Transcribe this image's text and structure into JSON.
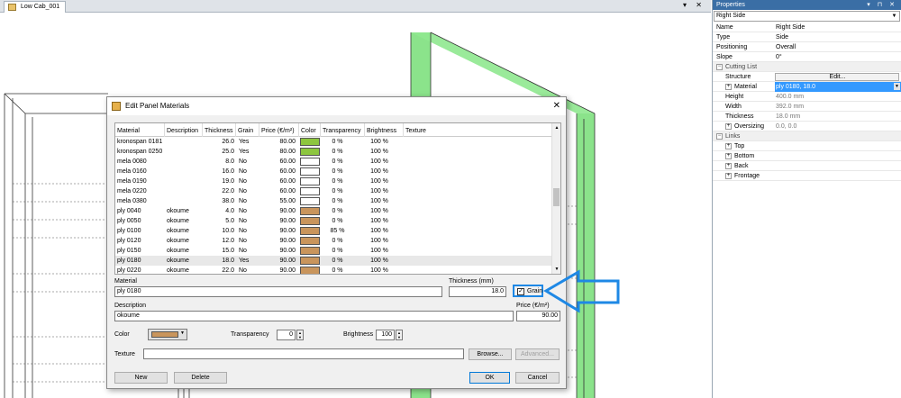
{
  "document_tab": {
    "title": "Low Cab_001"
  },
  "viewport_controls": {
    "pin": "▾",
    "close": "✕"
  },
  "properties": {
    "title": "Properties",
    "controls": "▾ ⊓ ✕",
    "selected_object": "Right Side",
    "rows": [
      {
        "key": "Name",
        "value": "Right Side"
      },
      {
        "key": "Type",
        "value": "Side"
      },
      {
        "key": "Positioning",
        "value": "Overall"
      },
      {
        "key": "Slope",
        "value": "0°"
      }
    ],
    "cutting_list": {
      "label": "Cutting List",
      "structure_key": "Structure",
      "structure_value": "Edit...",
      "material_key": "Material",
      "material_value": "ply 0180, 18.0",
      "height_key": "Height",
      "height_value": "400.0 mm",
      "width_key": "Width",
      "width_value": "392.0 mm",
      "thickness_key": "Thickness",
      "thickness_value": "18.0 mm",
      "oversizing_key": "Oversizing",
      "oversizing_value": "0.0, 0.0"
    },
    "links": {
      "label": "Links",
      "items": [
        "Top",
        "Bottom",
        "Back",
        "Frontage"
      ]
    }
  },
  "dialog": {
    "title": "Edit Panel Materials",
    "close": "✕",
    "columns": [
      "Material",
      "Description",
      "Thickness",
      "Grain",
      "Price (€/m²)",
      "Color",
      "Transparency",
      "Brightness",
      "Texture"
    ],
    "rows": [
      {
        "material": "kronospan 0181",
        "description": "",
        "thickness": "26.0",
        "grain": "Yes",
        "price": "80.00",
        "color": "#8dc63f",
        "transparency": "0 %",
        "brightness": "100 %"
      },
      {
        "material": "kronospan 0250",
        "description": "",
        "thickness": "25.0",
        "grain": "Yes",
        "price": "80.00",
        "color": "#8dc63f",
        "transparency": "0 %",
        "brightness": "100 %"
      },
      {
        "material": "mela 0080",
        "description": "",
        "thickness": "8.0",
        "grain": "No",
        "price": "60.00",
        "color": "#ffffff",
        "transparency": "0 %",
        "brightness": "100 %"
      },
      {
        "material": "mela 0160",
        "description": "",
        "thickness": "16.0",
        "grain": "No",
        "price": "60.00",
        "color": "#ffffff",
        "transparency": "0 %",
        "brightness": "100 %"
      },
      {
        "material": "mela 0190",
        "description": "",
        "thickness": "19.0",
        "grain": "No",
        "price": "60.00",
        "color": "#ffffff",
        "transparency": "0 %",
        "brightness": "100 %"
      },
      {
        "material": "mela 0220",
        "description": "",
        "thickness": "22.0",
        "grain": "No",
        "price": "60.00",
        "color": "#ffffff",
        "transparency": "0 %",
        "brightness": "100 %"
      },
      {
        "material": "mela 0380",
        "description": "",
        "thickness": "38.0",
        "grain": "No",
        "price": "55.00",
        "color": "#ffffff",
        "transparency": "0 %",
        "brightness": "100 %"
      },
      {
        "material": "ply 0040",
        "description": "okoume",
        "thickness": "4.0",
        "grain": "No",
        "price": "90.00",
        "color": "#c9955c",
        "transparency": "0 %",
        "brightness": "100 %"
      },
      {
        "material": "ply 0050",
        "description": "okoume",
        "thickness": "5.0",
        "grain": "No",
        "price": "90.00",
        "color": "#c9955c",
        "transparency": "0 %",
        "brightness": "100 %"
      },
      {
        "material": "ply 0100",
        "description": "okoume",
        "thickness": "10.0",
        "grain": "No",
        "price": "90.00",
        "color": "#c9955c",
        "transparency": "85 %",
        "brightness": "100 %"
      },
      {
        "material": "ply 0120",
        "description": "okoume",
        "thickness": "12.0",
        "grain": "No",
        "price": "90.00",
        "color": "#c9955c",
        "transparency": "0 %",
        "brightness": "100 %"
      },
      {
        "material": "ply 0150",
        "description": "okoume",
        "thickness": "15.0",
        "grain": "No",
        "price": "90.00",
        "color": "#c9955c",
        "transparency": "0 %",
        "brightness": "100 %"
      },
      {
        "material": "ply 0180",
        "description": "okoume",
        "thickness": "18.0",
        "grain": "Yes",
        "price": "90.00",
        "color": "#c9955c",
        "transparency": "0 %",
        "brightness": "100 %",
        "selected": true
      },
      {
        "material": "ply 0220",
        "description": "okoume",
        "thickness": "22.0",
        "grain": "No",
        "price": "90.00",
        "color": "#c9955c",
        "transparency": "0 %",
        "brightness": "100 %"
      }
    ],
    "material_label": "Material",
    "material_value": "ply 0180",
    "thickness_label": "Thickness (mm)",
    "thickness_value": "18.0",
    "grain_label": "Grain",
    "grain_checked": "✓",
    "description_label": "Description",
    "description_value": "okoume",
    "price_label": "Price (€/m²)",
    "price_value": "90.00",
    "color_label": "Color",
    "color_value": "#c9955c",
    "transparency_label": "Transparency",
    "transparency_value": "0",
    "brightness_label": "Brightness",
    "brightness_value": "100",
    "texture_label": "Texture",
    "texture_value": "",
    "browse_label": "Browse...",
    "advanced_label": "Advanced...",
    "new_label": "New",
    "delete_label": "Delete",
    "ok_label": "OK",
    "cancel_label": "Cancel"
  },
  "colors": {
    "highlight_panel": "#7ee07e",
    "annotation_arrow": "#1e88e5",
    "title_bar": "#3a6ea5",
    "selection": "#3399ff"
  }
}
